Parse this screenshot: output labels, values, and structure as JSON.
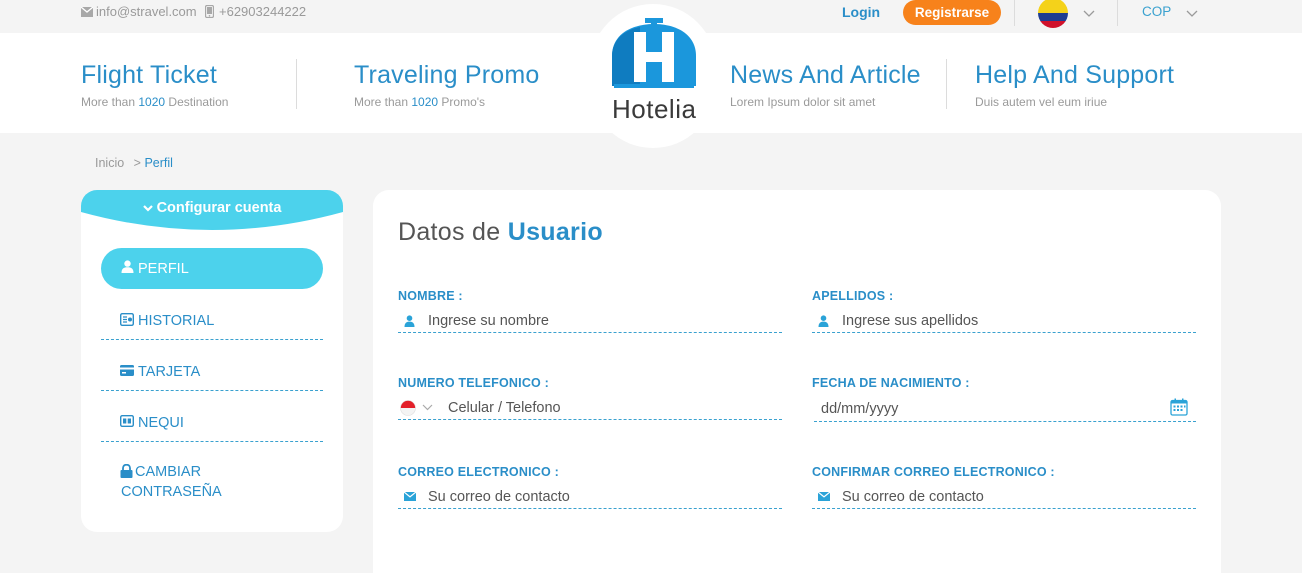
{
  "topbar": {
    "email": "info@stravel.com",
    "phone": "+62903244222",
    "login_label": "Login",
    "register_label": "Registrarse",
    "currency": "COP",
    "flag_icon": "colombia-flag-icon"
  },
  "nav": {
    "items": [
      {
        "title": "Flight Ticket",
        "sub_prefix": "More than ",
        "sub_highlight": "1020",
        "sub_suffix": " Destination"
      },
      {
        "title": "Traveling Promo",
        "sub_prefix": "More than ",
        "sub_highlight": "1020",
        "sub_suffix": " Promo's"
      },
      {
        "title": "News And Article",
        "sub": "Lorem Ipsum dolor sit amet"
      },
      {
        "title": "Help And Support",
        "sub": "Duis autem vel eum iriue"
      }
    ],
    "logo_text": "Hotelia"
  },
  "breadcrumb": {
    "home": "Inicio",
    "separator": ">",
    "current": "Perfil"
  },
  "sidebar": {
    "header": "Configurar cuenta",
    "items": [
      {
        "label": "PERFIL",
        "icon": "user-icon",
        "active": true
      },
      {
        "label": "HISTORIAL",
        "icon": "history-icon"
      },
      {
        "label": "TARJETA",
        "icon": "credit-card-icon"
      },
      {
        "label": "NEQUI",
        "icon": "wallet-icon"
      },
      {
        "label": "CAMBIAR",
        "label2": "CONTRASEÑA",
        "icon": "lock-icon"
      }
    ]
  },
  "form": {
    "title_prefix": "Datos de ",
    "title_highlight": "Usuario",
    "nombre": {
      "label": "NOMBRE :",
      "placeholder": "Ingrese su nombre"
    },
    "apellidos": {
      "label": "APELLIDOS :",
      "placeholder": "Ingrese sus apellidos"
    },
    "telefono": {
      "label": "NUMERO TELEFONICO :",
      "placeholder": "Celular / Telefono"
    },
    "nacimiento": {
      "label": "FECHA DE NACIMIENTO :",
      "placeholder": "dd/mm/yyyy"
    },
    "correo": {
      "label": "CORREO ELECTRONICO :",
      "placeholder": "Su correo de contacto"
    },
    "confirmar": {
      "label": "CONFIRMAR CORREO ELECTRONICO :",
      "placeholder": "Su correo de contacto"
    }
  },
  "colors": {
    "accent": "#2a8ec8",
    "cyan": "#4cd2ec",
    "orange": "#f7821b",
    "background": "#f4f4f4"
  }
}
